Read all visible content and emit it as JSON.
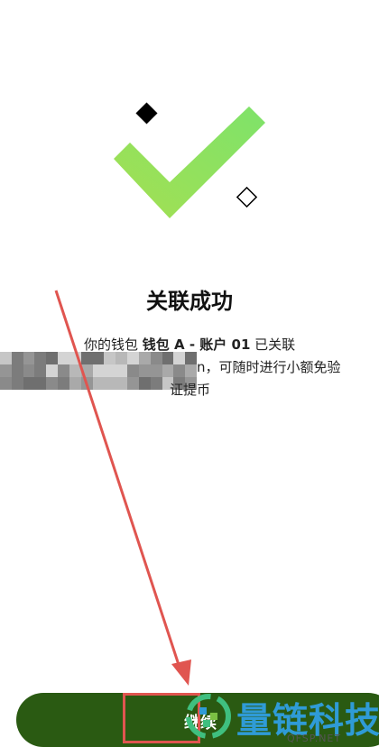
{
  "status": {
    "title": "关联成功",
    "line1_prefix": "你的钱包 ",
    "line1_wallet": "钱包 A - 账户 01",
    "line1_suffix": " 已关联",
    "line2_partial": "n，可随时进行小额免验",
    "line3_partial": "证提币"
  },
  "actions": {
    "continue_label": "继续"
  },
  "watermark": {
    "brand": "量链科技",
    "domain": "QFSP.NET"
  },
  "colors": {
    "primary_button": "#2a5a12",
    "check_green": "#8ee55a",
    "annotation_red": "#e05550",
    "brand_blue": "#2f9bd6"
  },
  "icons": {
    "success": "check-mark-icon",
    "deco1": "filled-diamond-icon",
    "deco2": "outline-diamond-icon",
    "annotation": "red-arrow-annotation"
  }
}
